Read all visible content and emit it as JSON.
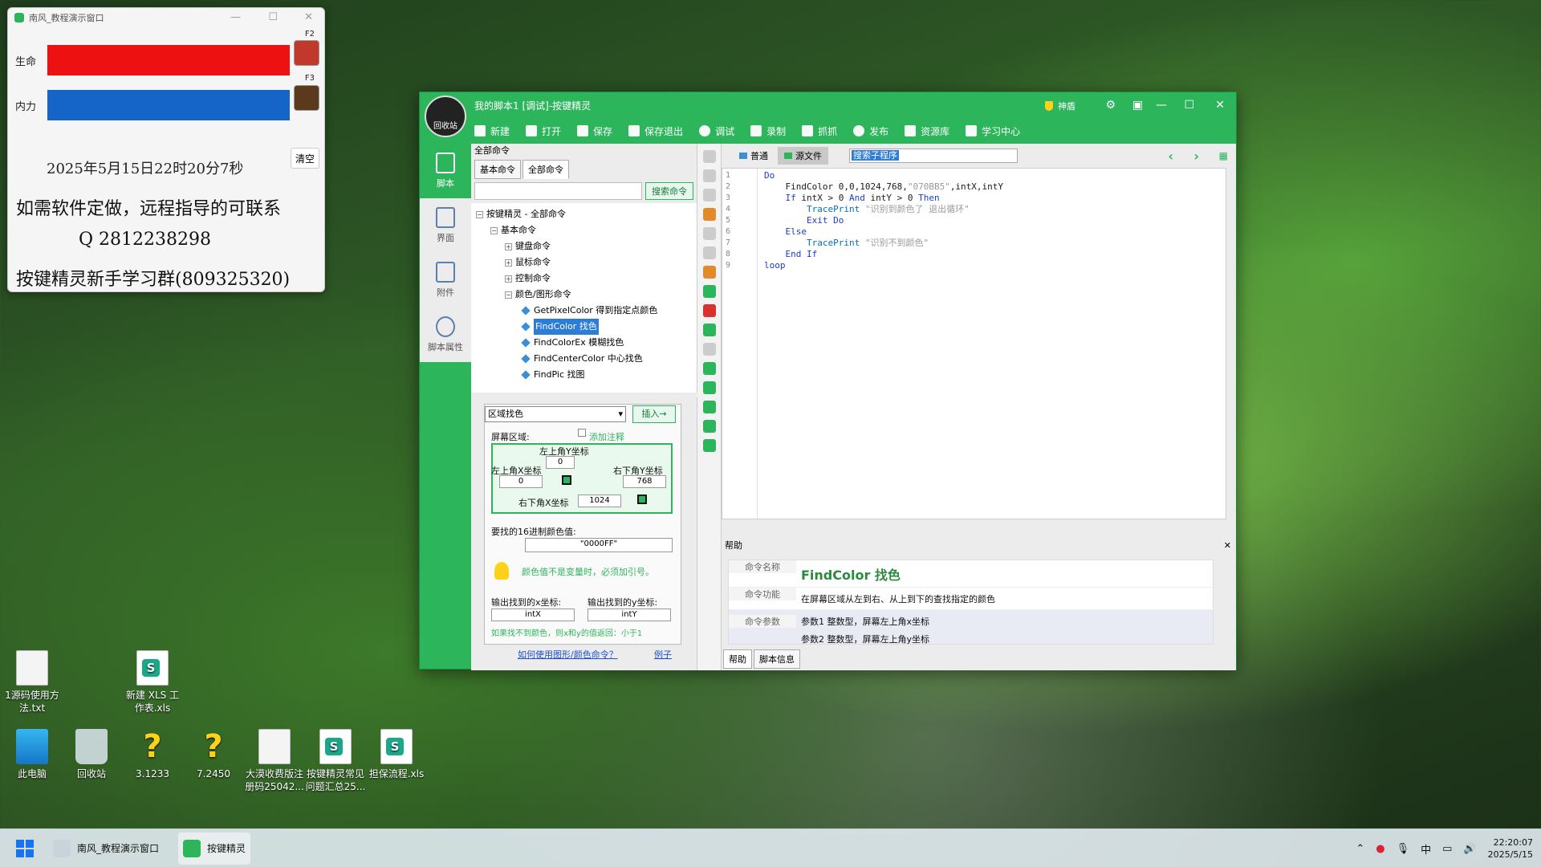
{
  "demo_window": {
    "title": "南风_教程演示窗口",
    "life_label": "生命",
    "mana_label": "内力",
    "life_color": "#ee1111",
    "mana_color": "#1565c8",
    "f2": "F2",
    "f3": "F3",
    "datetime": "2025年5月15日22时20分7秒",
    "clear_button": "清空",
    "line1": "如需软件定做，远程指导的可联系",
    "line2": "Q 2812238298",
    "line3": "按键精灵新手学习群(809325320)"
  },
  "desktop_icons": [
    {
      "label_line1": "1源码使用方",
      "label_line2": "法.txt"
    },
    {
      "label_line1": "新建 XLS 工",
      "label_line2": "作表.xls"
    },
    {
      "label_line1": "此电脑",
      "label_line2": ""
    },
    {
      "label_line1": "回收站",
      "label_line2": ""
    },
    {
      "label_line1": "3.1233",
      "label_line2": ""
    },
    {
      "label_line1": "7.2450",
      "label_line2": ""
    },
    {
      "label_line1": "大漠收费版注",
      "label_line2": "册码25042..."
    },
    {
      "label_line1": "按键精灵常见",
      "label_line2": "问题汇总25..."
    },
    {
      "label_line1": "担保流程.xls",
      "label_line2": ""
    }
  ],
  "main_window": {
    "title": "我的脚本1 [调试]-按键精灵",
    "logo_label": "回收站",
    "shield_label": "神盾",
    "accent_color": "#2db55c",
    "toolbar": [
      "新建",
      "打开",
      "保存",
      "保存退出",
      "调试",
      "录制",
      "抓抓",
      "发布",
      "资源库",
      "学习中心"
    ],
    "nav": [
      "脚本",
      "界面",
      "附件",
      "脚本属性"
    ],
    "cmd_panel": {
      "header": "全部命令",
      "tabs": [
        "基本命令",
        "全部命令"
      ],
      "search_button": "搜索命令",
      "tree": [
        {
          "label": "按键精灵 - 全部命令",
          "level": 0
        },
        {
          "label": "基本命令",
          "level": 1
        },
        {
          "label": "键盘命令",
          "level": 2
        },
        {
          "label": "鼠标命令",
          "level": 2
        },
        {
          "label": "控制命令",
          "level": 2
        },
        {
          "label": "颜色/图形命令",
          "level": 2
        },
        {
          "label": "GetPixelColor 得到指定点颜色",
          "level": 3
        },
        {
          "label": "FindColor 找色",
          "level": 3,
          "selected": true
        },
        {
          "label": "FindColorEx 模糊找色",
          "level": 3
        },
        {
          "label": "FindCenterColor 中心找色",
          "level": 3
        },
        {
          "label": "FindPic 找图",
          "level": 3
        }
      ]
    },
    "insert_panel": {
      "mode": "区域找色",
      "insert_button": "插入→",
      "screen_region": "屏幕区域:",
      "add_comment": "添加注释",
      "top_left_y_label": "左上角Y坐标",
      "top_left_y": "0",
      "top_left_x_label": "左上角X坐标",
      "top_left_x": "0",
      "bottom_right_y_label": "右下角Y坐标",
      "bottom_right_y": "768",
      "bottom_right_x_label": "右下角X坐标",
      "bottom_right_x": "1024",
      "color_label": "要找的16进制颜色值:",
      "color_value": "\"0000FF\"",
      "warning": "颜色值不是变量时，必须加引号。",
      "out_x_label": "输出找到的x坐标:",
      "out_y_label": "输出找到的y坐标:",
      "out_x": "intX",
      "out_y": "intY",
      "note": "如果找不到颜色，则x和y的值返回：小于1",
      "help_link": "如何使用图形/颜色命令？",
      "example_link": "例子"
    },
    "editor": {
      "mode_normal": "普通",
      "mode_source": "源文件",
      "sub_select": "搜索子程序",
      "line_numbers": [
        "1",
        "2",
        "3",
        "4",
        "5",
        "6",
        "7",
        "8",
        "9"
      ]
    },
    "help": {
      "header": "帮助",
      "name_key": "命令名称",
      "name_val": "FindColor 找色",
      "func_key": "命令功能",
      "func_val": "在屏幕区域从左到右、从上到下的查找指定的颜色",
      "param_key": "命令参数",
      "param_val1": "参数1 整数型，屏幕左上角x坐标",
      "param_val2": "参数2 整数型，屏幕左上角y坐标",
      "tab1": "帮助",
      "tab2": "脚本信息"
    }
  },
  "taskbar": {
    "task1": "南风_教程演示窗口",
    "task2": "按键精灵",
    "ime": "中",
    "time": "22:20:07",
    "date": "2025/5/15"
  }
}
